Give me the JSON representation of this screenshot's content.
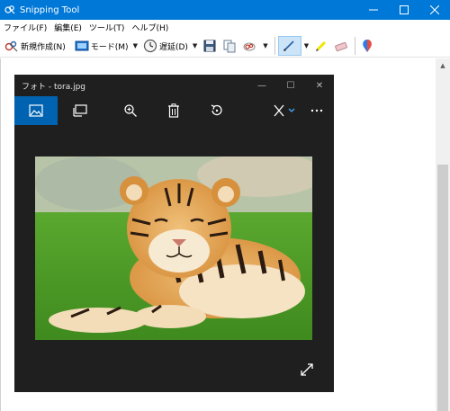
{
  "window": {
    "title": "Snipping Tool",
    "controls": [
      "minimize",
      "maximize",
      "close"
    ]
  },
  "menu": [
    {
      "label": "ファイル(F)"
    },
    {
      "label": "編集(E)"
    },
    {
      "label": "ツール(T)"
    },
    {
      "label": "ヘルプ(H)"
    }
  ],
  "toolbar": {
    "new_label": "新規作成(N)",
    "mode_label": "モード(M)",
    "delay_label": "遅延(D)",
    "icons": [
      "new-snip-icon",
      "mode-icon",
      "delay-clock-icon",
      "save-icon",
      "copy-icon",
      "send-snip-icon",
      "pen-icon",
      "highlighter-icon",
      "eraser-icon",
      "paint3d-icon"
    ]
  },
  "photo_window": {
    "title": "フォト - tora.jpg",
    "tools": [
      "view-image-icon",
      "slideshow-icon",
      "zoom-icon",
      "delete-icon",
      "rotate-icon",
      "edit-create-icon",
      "more-icon"
    ],
    "image_subject": "tiger cub lying on grass",
    "accent_color": "#0063b1"
  },
  "colors": {
    "titlebar": "#0078d7",
    "photo_bg": "#1f1f1f"
  }
}
